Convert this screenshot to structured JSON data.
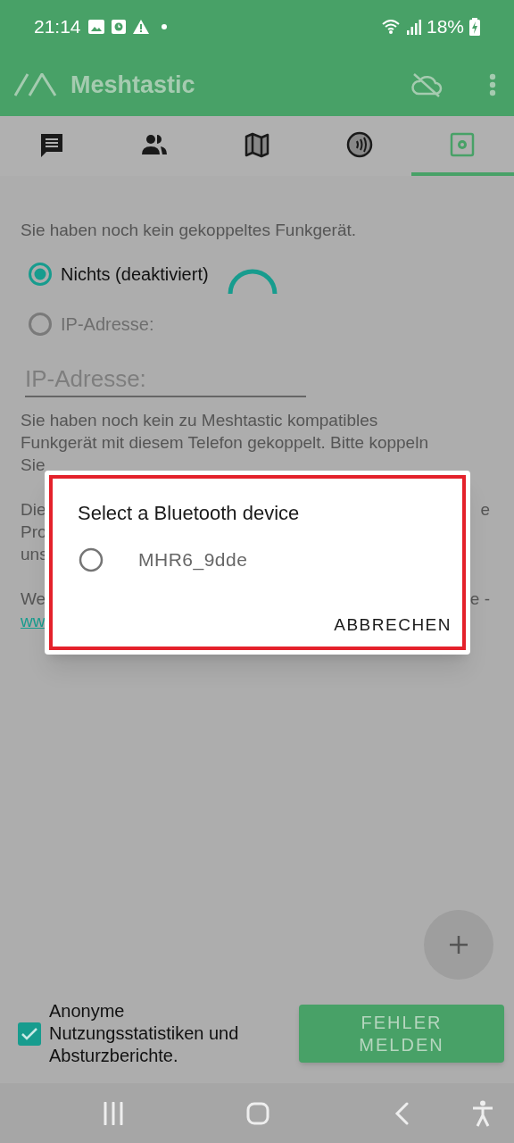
{
  "status_bar": {
    "time": "21:14",
    "battery": "18%"
  },
  "app_bar": {
    "title": "Meshtastic"
  },
  "tabs": [
    {
      "kind": "messages",
      "selected": false
    },
    {
      "kind": "nodes",
      "selected": false
    },
    {
      "kind": "map",
      "selected": false
    },
    {
      "kind": "channel",
      "selected": false
    },
    {
      "kind": "settings",
      "selected": true
    }
  ],
  "intro": "Sie haben noch kein gekoppeltes Funkgerät.",
  "options": [
    {
      "label": "Nichts (deaktiviert)",
      "selected": true,
      "disabled": false
    },
    {
      "label": "IP-Adresse:",
      "selected": false,
      "disabled": true
    }
  ],
  "ip_field": {
    "placeholder": "IP-Adresse:"
  },
  "paragraphs": [
    [
      {
        "left": "Sie haben noch kein zu Meshtastic kompatibles"
      },
      {
        "left": "Funkgerät mit diesem Telefon gekoppelt. Bitte koppeln"
      },
      {
        "left": "Sie"
      }
    ],
    [
      {
        "left": "Die",
        "right": "e"
      },
      {
        "left": "Pro"
      },
      {
        "left": "uns"
      }
    ],
    [
      {
        "left": "We",
        "right": "e -"
      },
      {
        "left": "ww",
        "kind": "link"
      }
    ]
  ],
  "dialog": {
    "title": "Select a Bluetooth device",
    "devices": [
      {
        "name": "MHR6_9dde",
        "selected": false
      }
    ],
    "action": "ABBRECHEN"
  },
  "analytics": {
    "label": "Anonyme Nutzungsstatistiken und Absturzberichte.",
    "checked": true
  },
  "report_button": "FEHLER MELDEN"
}
